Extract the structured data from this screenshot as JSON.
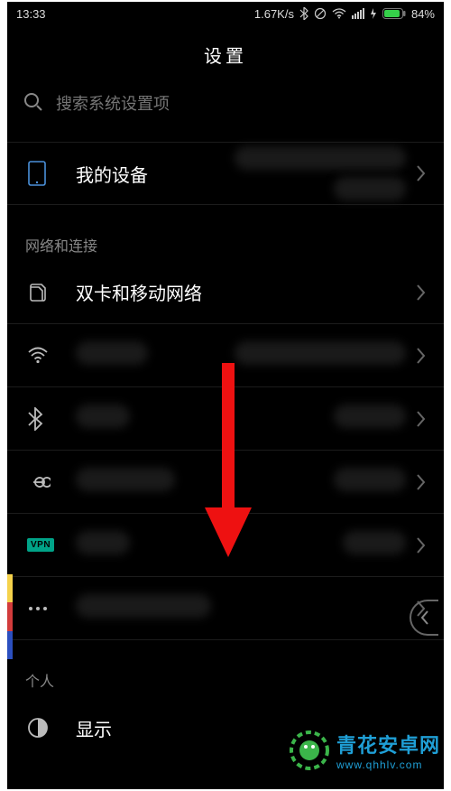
{
  "statusbar": {
    "time": "13:33",
    "net_speed": "1.67K/s",
    "battery_pct": "84%"
  },
  "page": {
    "title": "设置"
  },
  "search": {
    "placeholder": "搜索系统设置项"
  },
  "rows": {
    "my_device": {
      "label": "我的设备"
    },
    "dual_sim": {
      "label": "双卡和移动网络"
    },
    "display": {
      "label": "显示"
    }
  },
  "sections": {
    "network": "网络和连接",
    "personal": "个人"
  },
  "icons": {
    "vpn_label": "VPN"
  },
  "watermark": {
    "brand_cn": "青花安卓网",
    "url": "www.qhhlv.com"
  }
}
